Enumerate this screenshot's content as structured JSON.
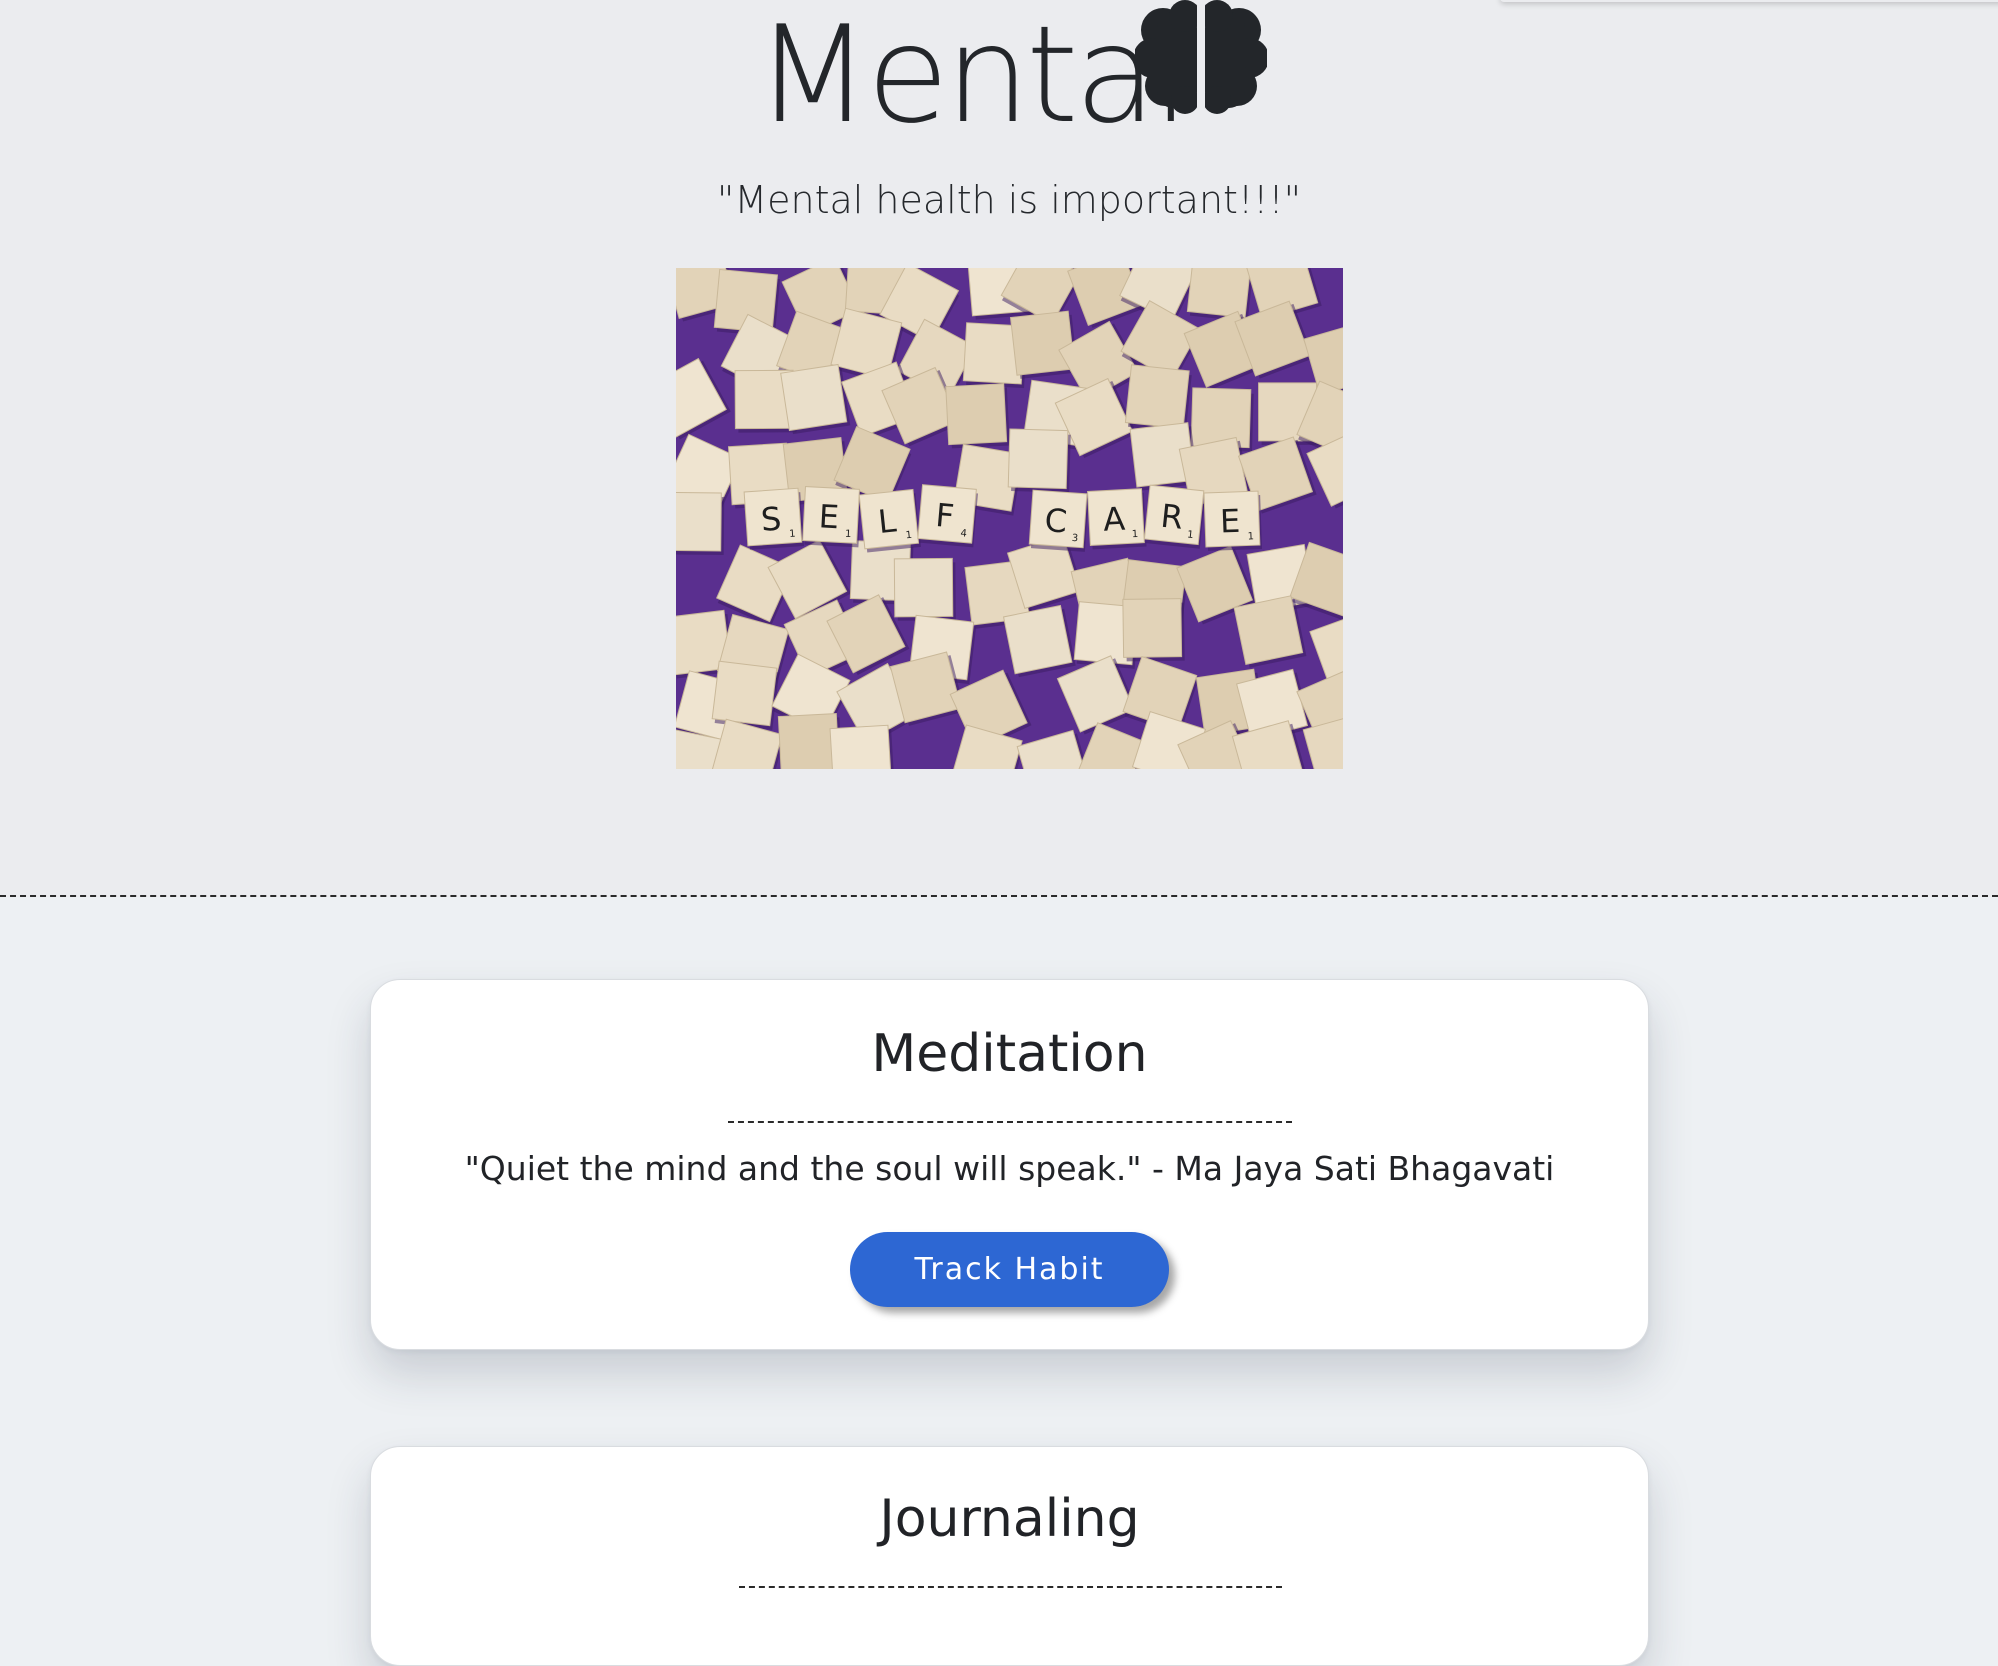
{
  "header": {
    "brand_title": "Mental",
    "brand_icon": "brain-icon",
    "tagline": "\"Mental health is important!!!\"",
    "hero_image": {
      "tile_letters": [
        "S",
        "E",
        "L",
        "F",
        "C",
        "A",
        "R",
        "E"
      ],
      "tile_scores": [
        "1",
        "1",
        "1",
        "4",
        "3",
        "1",
        "1",
        "1"
      ]
    }
  },
  "habits": [
    {
      "title": "Meditation",
      "quote": "\"Quiet the mind and the soul will speak.\" - Ma Jaya Sati Bhagavati",
      "button_label": "Track Habit"
    },
    {
      "title": "Journaling"
    }
  ],
  "colors": {
    "hero_background": "#ebecef",
    "page_background": "#edf0f3",
    "button_blue": "#2d67d3",
    "text_dark": "#222428",
    "image_purple": "#5a2f8f",
    "tile_wood": "#e8dcc6"
  }
}
